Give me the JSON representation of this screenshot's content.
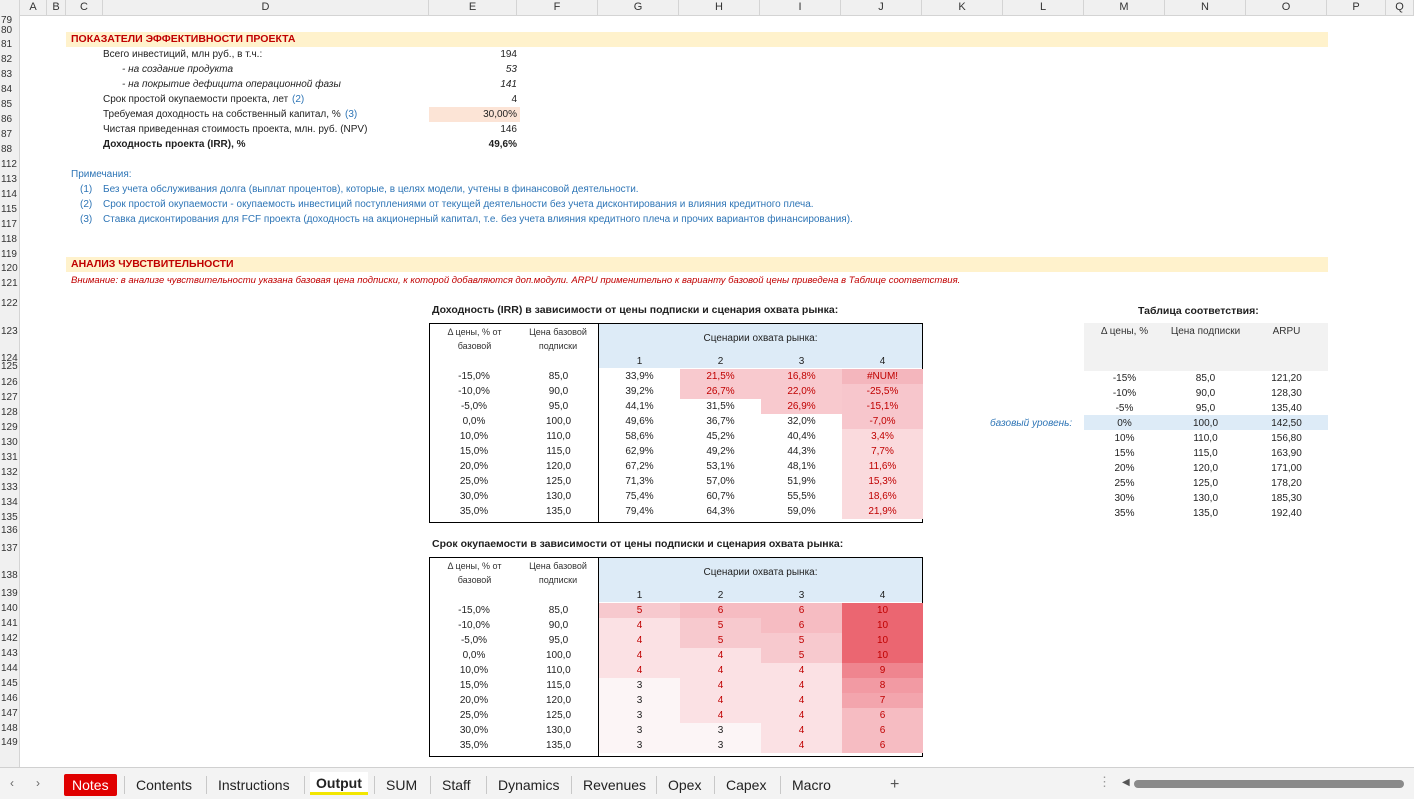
{
  "columns": [
    "A",
    "B",
    "C",
    "D",
    "E",
    "F",
    "G",
    "H",
    "I",
    "J",
    "K",
    "L",
    "M",
    "N",
    "O",
    "P",
    "Q"
  ],
  "rows": [
    "79",
    "80",
    "81",
    "82",
    "83",
    "84",
    "85",
    "86",
    "87",
    "88",
    "112",
    "113",
    "114",
    "115",
    "117",
    "118",
    "119",
    "120",
    "121",
    "122",
    "123",
    "124",
    "125",
    "126",
    "127",
    "128",
    "129",
    "130",
    "131",
    "132",
    "133",
    "134",
    "135",
    "136",
    "137",
    "138",
    "139",
    "140",
    "141",
    "142",
    "143",
    "144",
    "145",
    "146",
    "147",
    "148",
    "149"
  ],
  "kpi": {
    "title": "ПОКАЗАТЕЛИ ЭФФЕКТИВНОСТИ ПРОЕКТА",
    "rows": [
      {
        "label": "Всего инвестиций, млн руб., в т.ч.:",
        "note": "",
        "value": "194"
      },
      {
        "label": "- на создание продукта",
        "note": "",
        "value": "53"
      },
      {
        "label": "- на покрытие дефицита операционной фазы",
        "note": "",
        "value": "141"
      },
      {
        "label": "Срок простой окупаемости проекта, лет",
        "note": "(2)",
        "value": "4"
      },
      {
        "label": "Требуемая доходность на собственный капитал, %",
        "note": "(3)",
        "value": "30,00%"
      },
      {
        "label": "Чистая приведенная стоимость проекта, млн. руб. (NPV)",
        "note": "",
        "value": "146"
      },
      {
        "label": "Доходность проекта (IRR), %",
        "note": "",
        "value": "49,6%"
      }
    ]
  },
  "notes": {
    "header": "Примечания:",
    "items": [
      {
        "num": "(1)",
        "text": "Без учета обслуживания долга (выплат процентов), которые, в целях модели, учтены в финансовой деятельности."
      },
      {
        "num": "(2)",
        "text": "Срок простой окупаемости - окупаемость инвестиций поступлениями от текущей деятельности без учета дисконтирования и влияния кредитного плеча."
      },
      {
        "num": "(3)",
        "text": "Ставка дисконтирования для FCF проекта (доходность на акционерный капитал, т.е. без учета влияния кредитного плеча и прочих вариантов финансирования)."
      }
    ]
  },
  "sens": {
    "title": "АНАЛИЗ ЧУВСТВИТЕЛЬНОСТИ",
    "warning": "Внимание: в анализе чувствительности указана базовая цена подписки, к которой добавляются доп.модули. ARPU применительно к варианту базовой цены приведена в Таблице соответствия."
  },
  "irr_table": {
    "title": "Доходность (IRR) в зависимости от цены подписки и сценария охвата рынка:",
    "col1": "Δ цены, % от базовой",
    "col2": "Цена базовой подписки",
    "scen": "Сценарии охвата рынка:",
    "scen_nums": [
      "1",
      "2",
      "3",
      "4"
    ],
    "deltas": [
      "-15,0%",
      "-10,0%",
      "-5,0%",
      "0,0%",
      "10,0%",
      "15,0%",
      "20,0%",
      "25,0%",
      "30,0%",
      "35,0%"
    ],
    "prices": [
      "85,0",
      "90,0",
      "95,0",
      "100,0",
      "110,0",
      "115,0",
      "120,0",
      "125,0",
      "130,0",
      "135,0"
    ],
    "values": [
      [
        "33,9%",
        "21,5%",
        "16,8%",
        "#NUM!"
      ],
      [
        "39,2%",
        "26,7%",
        "22,0%",
        "-25,5%"
      ],
      [
        "44,1%",
        "31,5%",
        "26,9%",
        "-15,1%"
      ],
      [
        "49,6%",
        "36,7%",
        "32,0%",
        "-7,0%"
      ],
      [
        "58,6%",
        "45,2%",
        "40,4%",
        "3,4%"
      ],
      [
        "62,9%",
        "49,2%",
        "44,3%",
        "7,7%"
      ],
      [
        "67,2%",
        "53,1%",
        "48,1%",
        "11,6%"
      ],
      [
        "71,3%",
        "57,0%",
        "51,9%",
        "15,3%"
      ],
      [
        "75,4%",
        "60,7%",
        "55,5%",
        "18,6%"
      ],
      [
        "79,4%",
        "64,3%",
        "59,0%",
        "21,9%"
      ]
    ]
  },
  "payback_table": {
    "title": "Срок окупаемости в зависимости от цены подписки и сценария охвата рынка:",
    "col1": "Δ цены, % от базовой",
    "col2": "Цена базовой подписки",
    "scen": "Сценарии охвата рынка:",
    "scen_nums": [
      "1",
      "2",
      "3",
      "4"
    ],
    "deltas": [
      "-15,0%",
      "-10,0%",
      "-5,0%",
      "0,0%",
      "10,0%",
      "15,0%",
      "20,0%",
      "25,0%",
      "30,0%",
      "35,0%"
    ],
    "prices": [
      "85,0",
      "90,0",
      "95,0",
      "100,0",
      "110,0",
      "115,0",
      "120,0",
      "125,0",
      "130,0",
      "135,0"
    ],
    "values": [
      [
        "5",
        "6",
        "6",
        "10"
      ],
      [
        "4",
        "5",
        "6",
        "10"
      ],
      [
        "4",
        "5",
        "5",
        "10"
      ],
      [
        "4",
        "4",
        "5",
        "10"
      ],
      [
        "4",
        "4",
        "4",
        "9"
      ],
      [
        "3",
        "4",
        "4",
        "8"
      ],
      [
        "3",
        "4",
        "4",
        "7"
      ],
      [
        "3",
        "4",
        "4",
        "6"
      ],
      [
        "3",
        "3",
        "4",
        "6"
      ],
      [
        "3",
        "3",
        "4",
        "6"
      ]
    ]
  },
  "match_table": {
    "title": "Таблица соответствия:",
    "headers": [
      "Δ цены, %",
      "Цена подписки",
      "ARPU"
    ],
    "base_label": "базовый уровень:",
    "rows": [
      [
        "-15%",
        "85,0",
        "121,20"
      ],
      [
        "-10%",
        "90,0",
        "128,30"
      ],
      [
        "-5%",
        "95,0",
        "135,40"
      ],
      [
        "0%",
        "100,0",
        "142,50"
      ],
      [
        "10%",
        "110,0",
        "156,80"
      ],
      [
        "15%",
        "115,0",
        "163,90"
      ],
      [
        "20%",
        "120,0",
        "171,00"
      ],
      [
        "25%",
        "125,0",
        "178,20"
      ],
      [
        "30%",
        "130,0",
        "185,30"
      ],
      [
        "35%",
        "135,0",
        "192,40"
      ]
    ]
  },
  "tabs": [
    "Notes",
    "Contents",
    "Instructions",
    "Output",
    "SUM",
    "Staff",
    "Dynamics",
    "Revenues",
    "Opex",
    "Capex",
    "Macro"
  ],
  "active_tab": "Output",
  "add_sheet": "+",
  "colors": {
    "section_bg": "#fff2cc",
    "title_red": "#c00000",
    "note_blue": "#2e75b6",
    "header_blue": "#ddebf7",
    "input_orange": "#fce4d6"
  }
}
